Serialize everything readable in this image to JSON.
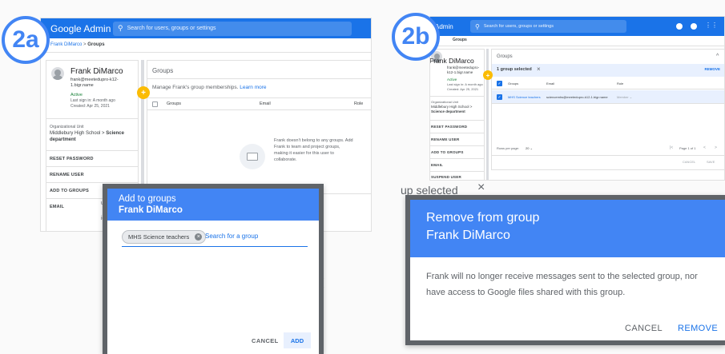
{
  "left": {
    "badge": "2a",
    "app_title": "Google Admin",
    "search_placeholder": "Search for users, groups or settings",
    "breadcrumb": {
      "parent": "Frank DiMarco",
      "sep": ">",
      "current": "Groups"
    },
    "user": {
      "name": "Frank DiMarco",
      "email": "frank@meetedupro-k12-1.bigr.name",
      "status": "Active",
      "last_sign_in": "Last sign in: A month ago",
      "created": "Created: Apr 25, 2021",
      "org_label": "Organizational Unit",
      "org_path": "Middlebury High School",
      "org_sep": ">",
      "org_current": "Science department"
    },
    "actions": [
      "RESET PASSWORD",
      "RENAME USER",
      "ADD TO GROUPS",
      "EMAIL"
    ],
    "groups_card": {
      "title": "Groups",
      "manage_text": "Manage Frank's group memberships.",
      "learn_more": "Learn more",
      "columns": [
        "Groups",
        "Email",
        "Role"
      ],
      "empty_text": "Frank doesn't belong to any groups. Add Frank to team and project groups, making it easier for this user to collaborate."
    },
    "dialog": {
      "title": "Add to groups",
      "subtitle": "Frank DiMarco",
      "chip": "MHS Science teachers",
      "search_placeholder": "Search for a group",
      "cancel": "CANCEL",
      "add": "ADD"
    },
    "bg_fragments": [
      "ups",
      "ido",
      "ar",
      "pr",
      "ul"
    ]
  },
  "right": {
    "badge": "2b",
    "app_title": "Admin",
    "search_placeholder": "Search for users, groups or settings",
    "breadcrumb": {
      "current": "Groups"
    },
    "user": {
      "name": "Frank DiMarco",
      "email": "frank@meetedupro-k12-1.bigr.name",
      "status": "Active",
      "last_sign_in": "Last sign in: A month ago",
      "created": "Created: Apr 25, 2021",
      "org_label": "Organizational Unit",
      "org_path": "Middlebury High School",
      "org_sep": ">",
      "org_current": "Science department"
    },
    "actions": [
      "RESET PASSWORD",
      "RENAME USER",
      "ADD TO GROUPS",
      "EMAIL",
      "SUSPEND USER"
    ],
    "groups_card": {
      "title": "Groups",
      "selected_text": "1 group selected",
      "remove": "REMOVE",
      "columns": [
        "Groups",
        "Email",
        "Role"
      ],
      "row": {
        "group": "MHS Science teachers",
        "email": "sciencemhs@meetedupro-k12-1.bigr.name",
        "role": "Member"
      },
      "rows_per_page_label": "Rows per page:",
      "rows_per_page": "20",
      "page_info": "Page 1 of 1",
      "cancel": "CANCEL",
      "save": "SAVE"
    },
    "bg_selected": "up selected",
    "dialog": {
      "title": "Remove from group",
      "subtitle": "Frank DiMarco",
      "body": "Frank will no longer receive messages sent to the selected group, nor have access to Google files shared with this group.",
      "cancel": "CANCEL",
      "remove": "REMOVE"
    }
  },
  "colors": {
    "brand_blue": "#1a73e8",
    "dialog_blue": "#4285f4",
    "accent_yellow": "#fbbc04"
  }
}
